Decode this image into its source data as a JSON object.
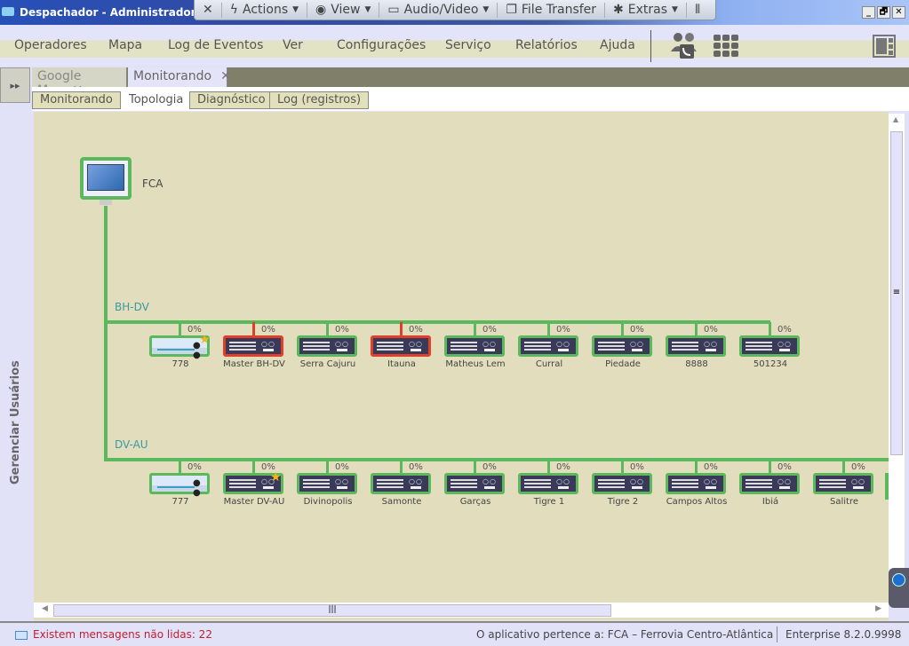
{
  "titlebar": {
    "title": "Despachador - Administrador",
    "tv_items": [
      {
        "icon": "close-icon",
        "glyph": "✕",
        "label": ""
      },
      {
        "icon": "lightning-icon",
        "glyph": "ϟ",
        "label": "Actions",
        "has_menu": true
      },
      {
        "icon": "eye-icon",
        "glyph": "◉",
        "label": "View",
        "has_menu": true
      },
      {
        "icon": "chat-icon",
        "glyph": "▭",
        "label": "Audio/Video",
        "has_menu": true
      },
      {
        "icon": "file-icon",
        "glyph": "❐",
        "label": "File Transfer"
      },
      {
        "icon": "puzzle-icon",
        "glyph": "✱",
        "label": "Extras",
        "has_menu": true
      },
      {
        "icon": "grip-icon",
        "glyph": "⦀",
        "label": ""
      }
    ],
    "window_buttons": {
      "minimize": "_",
      "restore": "🗗",
      "close": "✕"
    }
  },
  "menubar": {
    "items": [
      "Operadores",
      "Mapa",
      "Log de Eventos",
      "Ver",
      "Configurações",
      "Serviço",
      "Relatórios",
      "Ajuda"
    ]
  },
  "left_panel": {
    "expand_glyph": "▸▸",
    "label": "Gerenciar Usuários"
  },
  "doc_tabs": [
    {
      "label": "Google Map",
      "active": false
    },
    {
      "label": "Monitorando",
      "active": true
    }
  ],
  "sub_tabs": [
    {
      "label": "Monitorando",
      "active": false
    },
    {
      "label": "Topologia",
      "active": true
    },
    {
      "label": "Diagnóstico",
      "active": false
    },
    {
      "label": "Log (registros)",
      "active": false
    }
  ],
  "topology": {
    "host": "FCA",
    "networks": [
      {
        "name": "BH-DV",
        "devices": [
          {
            "name": "778",
            "type": "switch",
            "status": "ok",
            "load": "0%",
            "star": true
          },
          {
            "name": "Master BH-DV",
            "type": "radio",
            "status": "alarm",
            "load": "0%"
          },
          {
            "name": "Serra Cajuru",
            "type": "radio",
            "status": "ok",
            "load": "0%"
          },
          {
            "name": "Itauna",
            "type": "radio",
            "status": "alarm",
            "load": "0%"
          },
          {
            "name": "Matheus Lem",
            "type": "radio",
            "status": "ok",
            "load": "0%"
          },
          {
            "name": "Curral",
            "type": "radio",
            "status": "ok",
            "load": "0%"
          },
          {
            "name": "Piedade",
            "type": "radio",
            "status": "ok",
            "load": "0%"
          },
          {
            "name": "8888",
            "type": "radio",
            "status": "ok",
            "load": "0%"
          },
          {
            "name": "501234",
            "type": "radio",
            "status": "ok",
            "load": "0%"
          }
        ]
      },
      {
        "name": "DV-AU",
        "devices": [
          {
            "name": "777",
            "type": "switch",
            "status": "ok",
            "load": "0%"
          },
          {
            "name": "Master DV-AU",
            "type": "radio",
            "status": "ok",
            "load": "0%",
            "star": true
          },
          {
            "name": "Divinopolis",
            "type": "radio",
            "status": "ok",
            "load": "0%"
          },
          {
            "name": "Samonte",
            "type": "radio",
            "status": "ok",
            "load": "0%"
          },
          {
            "name": "Garças",
            "type": "radio",
            "status": "ok",
            "load": "0%"
          },
          {
            "name": "Tigre 1",
            "type": "radio",
            "status": "ok",
            "load": "0%"
          },
          {
            "name": "Tigre 2",
            "type": "radio",
            "status": "ok",
            "load": "0%"
          },
          {
            "name": "Campos Altos",
            "type": "radio",
            "status": "ok",
            "load": "0%"
          },
          {
            "name": "Ibiá",
            "type": "radio",
            "status": "ok",
            "load": "0%"
          },
          {
            "name": "Salitre",
            "type": "radio",
            "status": "ok",
            "load": "0%"
          }
        ]
      }
    ]
  },
  "statusbar": {
    "unread": "Existem mensagens não lidas: 22",
    "owner": "O aplicativo pertence a:   FCA – Ferrovia Centro-Atlântica",
    "version": "Enterprise 8.2.0.9998"
  },
  "colors": {
    "ok": "#5cb85c",
    "alarm": "#e0402a",
    "unread_text": "#c02030"
  }
}
